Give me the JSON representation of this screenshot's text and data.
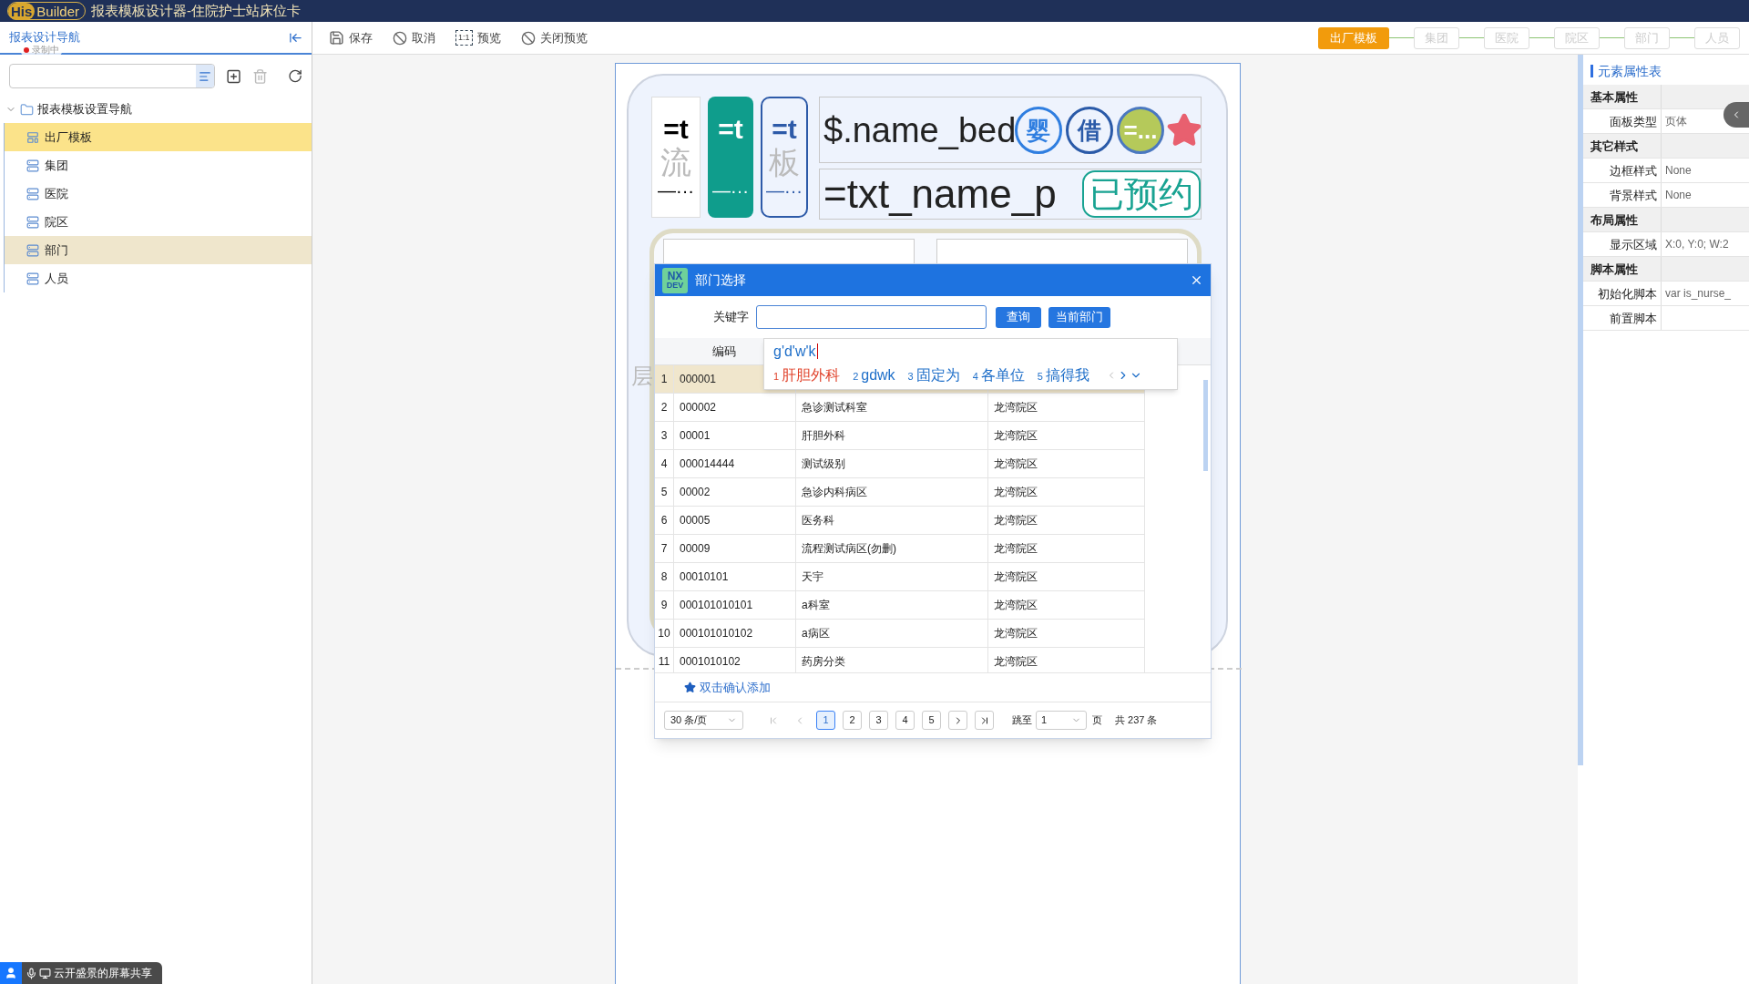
{
  "window": {
    "title": "报表模板设计器-住院护士站床位卡",
    "logo": [
      "His",
      "Builder"
    ]
  },
  "nav": {
    "title": "报表设计导航",
    "recording": "录制中",
    "tree": {
      "label": "报表模板设置导航",
      "expanded": true,
      "children": [
        {
          "label": "出厂模板",
          "kind": "template",
          "selected": true,
          "hovered": false
        },
        {
          "label": "集团",
          "kind": "list",
          "selected": false,
          "hovered": false
        },
        {
          "label": "医院",
          "kind": "list",
          "selected": false,
          "hovered": false
        },
        {
          "label": "院区",
          "kind": "list",
          "selected": false,
          "hovered": false
        },
        {
          "label": "部门",
          "kind": "list",
          "selected": false,
          "hovered": true
        },
        {
          "label": "人员",
          "kind": "list",
          "selected": false,
          "hovered": false
        }
      ]
    }
  },
  "toolbar": [
    {
      "kind": "save",
      "label": "保存"
    },
    {
      "kind": "cancel",
      "label": "取消"
    },
    {
      "kind": "preview",
      "label": "预览",
      "icon_text": "1:1"
    },
    {
      "kind": "close_preview",
      "label": "关闭预览"
    }
  ],
  "steps": [
    {
      "label": "出厂模板",
      "selected": true
    },
    {
      "label": "集团",
      "selected": false
    },
    {
      "label": "医院",
      "selected": false
    },
    {
      "label": "院区",
      "selected": false
    },
    {
      "label": "部门",
      "selected": false
    },
    {
      "label": "人员",
      "selected": false
    }
  ],
  "canvas": {
    "cells": [
      {
        "kind": "plain",
        "text": "=t",
        "label": "流",
        "footer": "—···"
      },
      {
        "kind": "filled",
        "text": "=t",
        "footer": "—···"
      },
      {
        "kind": "outlined",
        "text": "=t",
        "label": "板",
        "footer": "—···"
      }
    ],
    "title_field": "$.name_bed",
    "badges": [
      {
        "kind": "outline",
        "text": "婴",
        "color": "#2f7ee0"
      },
      {
        "kind": "outline",
        "text": "借",
        "color": "#2a5aa8"
      },
      {
        "kind": "filled",
        "text": "=...",
        "color": "#b5c95a"
      },
      {
        "kind": "star",
        "color": "#e8606f"
      }
    ],
    "subtitle_field": "=txt_name_p",
    "status_tag": "已预约",
    "side_label": "层"
  },
  "dialog": {
    "title": "部门选择",
    "logo": [
      "NX",
      "DEV"
    ],
    "keyword_label": "关键字",
    "buttons": [
      "查询",
      "当前部门"
    ],
    "table": {
      "columns": [
        "编码"
      ],
      "rows": [
        {
          "index": "1",
          "cells": [
            "000001"
          ],
          "selected": true
        },
        {
          "index": "2",
          "cells": [
            "000002",
            "急诊测试科室",
            "龙湾院区"
          ],
          "selected": false
        },
        {
          "index": "3",
          "cells": [
            "00001",
            "肝胆外科",
            "龙湾院区"
          ],
          "selected": false
        },
        {
          "index": "4",
          "cells": [
            "000014444",
            "测试级别",
            "龙湾院区"
          ],
          "selected": false
        },
        {
          "index": "5",
          "cells": [
            "00002",
            "急诊内科病区",
            "龙湾院区"
          ],
          "selected": false
        },
        {
          "index": "6",
          "cells": [
            "00005",
            "医务科",
            "龙湾院区"
          ],
          "selected": false
        },
        {
          "index": "7",
          "cells": [
            "00009",
            "流程测试病区(勿删)",
            "龙湾院区"
          ],
          "selected": false
        },
        {
          "index": "8",
          "cells": [
            "00010101",
            "天宇",
            "龙湾院区"
          ],
          "selected": false
        },
        {
          "index": "9",
          "cells": [
            "000101010101",
            "a科室",
            "龙湾院区"
          ],
          "selected": false
        },
        {
          "index": "10",
          "cells": [
            "000101010102",
            "a病区",
            "龙湾院区"
          ],
          "selected": false
        },
        {
          "index": "11",
          "cells": [
            "0001010102",
            "药房分类",
            "龙湾院区"
          ],
          "selected": false
        }
      ]
    },
    "hint": "双击确认添加",
    "pagination": {
      "page_size": "30 条/页",
      "pages": [
        {
          "label": "1",
          "selected": true
        },
        {
          "label": "2",
          "selected": false
        },
        {
          "label": "3",
          "selected": false
        },
        {
          "label": "4",
          "selected": false
        },
        {
          "label": "5",
          "selected": false
        }
      ],
      "jump_label": "跳至",
      "jump_value": "1",
      "page_unit": "页",
      "total": "共 237 条"
    }
  },
  "ime": {
    "composition": "g'd'w'k",
    "candidates": [
      {
        "index": "1",
        "text": "肝胆外科",
        "selected": true
      },
      {
        "index": "2",
        "text": "gdwk",
        "selected": false
      },
      {
        "index": "3",
        "text": "固定为",
        "selected": false
      },
      {
        "index": "4",
        "text": "各单位",
        "selected": false
      },
      {
        "index": "5",
        "text": "搞得我",
        "selected": false
      }
    ]
  },
  "properties": {
    "title": "元素属性表",
    "groups": [
      {
        "label": "基本属性",
        "rows": [
          {
            "label": "面板类型",
            "value": "页体"
          }
        ]
      },
      {
        "label": "其它样式",
        "rows": [
          {
            "label": "边框样式",
            "value": "None"
          },
          {
            "label": "背景样式",
            "value": "None"
          }
        ]
      },
      {
        "label": "布局属性",
        "rows": [
          {
            "label": "显示区域",
            "value": "X:0, Y:0; W:2"
          }
        ]
      },
      {
        "label": "脚本属性",
        "rows": [
          {
            "label": "初始化脚本",
            "value": "var is_nurse_"
          },
          {
            "label": "前置脚本"
          }
        ]
      }
    ]
  },
  "share_bar": {
    "text": "云开盛景的屏幕共享"
  }
}
